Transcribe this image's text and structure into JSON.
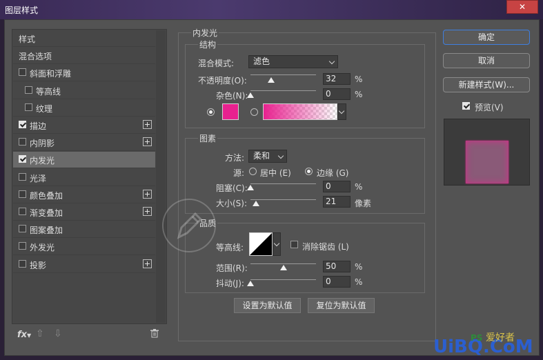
{
  "window": {
    "title": "图层样式",
    "close_glyph": "✕"
  },
  "styles_list": {
    "items": [
      {
        "label": "样式",
        "checkbox": false,
        "checked": false,
        "plus": false,
        "indent": 0,
        "selected": false
      },
      {
        "label": "混合选项",
        "checkbox": false,
        "checked": false,
        "plus": false,
        "indent": 0,
        "selected": false
      },
      {
        "label": "斜面和浮雕",
        "checkbox": true,
        "checked": false,
        "plus": false,
        "indent": 0,
        "selected": false
      },
      {
        "label": "等高线",
        "checkbox": true,
        "checked": false,
        "plus": false,
        "indent": 1,
        "selected": false
      },
      {
        "label": "纹理",
        "checkbox": true,
        "checked": false,
        "plus": false,
        "indent": 1,
        "selected": false
      },
      {
        "label": "描边",
        "checkbox": true,
        "checked": true,
        "plus": true,
        "indent": 0,
        "selected": false
      },
      {
        "label": "内阴影",
        "checkbox": true,
        "checked": false,
        "plus": true,
        "indent": 0,
        "selected": false
      },
      {
        "label": "内发光",
        "checkbox": true,
        "checked": true,
        "plus": false,
        "indent": 0,
        "selected": true
      },
      {
        "label": "光泽",
        "checkbox": true,
        "checked": false,
        "plus": false,
        "indent": 0,
        "selected": false
      },
      {
        "label": "颜色叠加",
        "checkbox": true,
        "checked": false,
        "plus": true,
        "indent": 0,
        "selected": false
      },
      {
        "label": "渐变叠加",
        "checkbox": true,
        "checked": false,
        "plus": true,
        "indent": 0,
        "selected": false
      },
      {
        "label": "图案叠加",
        "checkbox": true,
        "checked": false,
        "plus": false,
        "indent": 0,
        "selected": false
      },
      {
        "label": "外发光",
        "checkbox": true,
        "checked": false,
        "plus": false,
        "indent": 0,
        "selected": false
      },
      {
        "label": "投影",
        "checkbox": true,
        "checked": false,
        "plus": true,
        "indent": 0,
        "selected": false
      }
    ],
    "footer": {
      "fx_label": "fx",
      "up_glyph": "⇧",
      "down_glyph": "⇩",
      "trash_icon": "trash-icon"
    }
  },
  "inner_glow": {
    "title": "内发光",
    "structure": {
      "title": "结构",
      "blend_mode_label": "混合模式:",
      "blend_mode_value": "滤色",
      "opacity_label": "不透明度(O):",
      "opacity_value": "32",
      "opacity_fraction": 0.32,
      "noise_label": "杂色(N):",
      "noise_value": "0",
      "noise_fraction": 0.0,
      "percent": "%",
      "glow_color": "#e8218f"
    },
    "elements": {
      "title": "图素",
      "method_label": "方法:",
      "method_value": "柔和",
      "source_label": "源:",
      "source_center_label": "居中 (E)",
      "source_edge_label": "边缘 (G)",
      "source_selected": "edge",
      "choke_label": "阻塞(C):",
      "choke_value": "0",
      "choke_fraction": 0.0,
      "size_label": "大小(S):",
      "size_value": "21",
      "size_fraction": 0.085,
      "size_unit": "像素",
      "percent": "%"
    },
    "quality": {
      "title": "品质",
      "contour_label": "等高线:",
      "antialias_label": "消除锯齿 (L)",
      "antialias_checked": false,
      "range_label": "范围(R):",
      "range_value": "50",
      "range_fraction": 0.5,
      "jitter_label": "抖动(J):",
      "jitter_value": "0",
      "jitter_fraction": 0.0,
      "percent": "%"
    },
    "set_default_label": "设置为默认值",
    "reset_default_label": "复位为默认值"
  },
  "actions": {
    "ok_label": "确定",
    "cancel_label": "取消",
    "new_style_label": "新建样式(W)...",
    "preview_label": "预览(V)",
    "preview_checked": true
  },
  "colors": {
    "accent": "#3f7fe0",
    "glow": "#e8218f",
    "preview_square": "#8a5a78"
  }
}
